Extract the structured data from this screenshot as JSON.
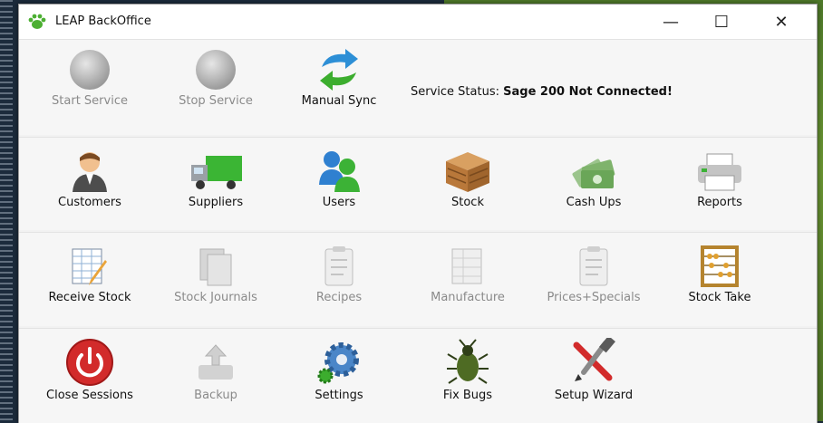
{
  "window": {
    "title": "LEAP BackOffice",
    "minimize": "—",
    "maximize": "☐",
    "close": "✕"
  },
  "service": {
    "start_label": "Start Service",
    "stop_label": "Stop Service",
    "sync_label": "Manual Sync",
    "status_label": "Service Status:",
    "status_value": "Sage 200 Not Connected!"
  },
  "row1": [
    "Customers",
    "Suppliers",
    "Users",
    "Stock",
    "Cash Ups",
    "Reports"
  ],
  "row2": [
    "Receive Stock",
    "Stock Journals",
    "Recipes",
    "Manufacture",
    "Prices+Specials",
    "Stock Take"
  ],
  "row3": [
    "Close Sessions",
    "Backup",
    "Settings",
    "Fix Bugs",
    "Setup Wizard"
  ],
  "colors": {
    "accent_green": "#3f9a2e",
    "danger_red": "#d22b2b",
    "disabled_gray": "#8a8a8a"
  }
}
